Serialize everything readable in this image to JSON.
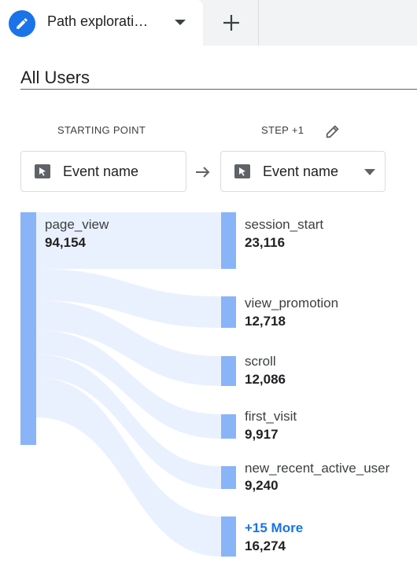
{
  "tabs": {
    "active_label": "Path explorati…",
    "active_icon": "pencil-icon",
    "dropdown_icon": "caret-down-icon",
    "add_icon": "plus-icon"
  },
  "segment": {
    "label": "All Users"
  },
  "columns": {
    "start_heading": "STARTING POINT",
    "step_heading": "STEP +1",
    "step_edit_icon": "pencil-icon",
    "start_dimension": "Event name",
    "step_dimension": "Event name",
    "dimension_icon": "cursor-box-icon",
    "arrow_icon": "arrow-right-icon"
  },
  "start_node": {
    "name": "page_view",
    "value": "94,154"
  },
  "step_nodes": [
    {
      "name": "session_start",
      "value": "23,116"
    },
    {
      "name": "view_promotion",
      "value": "12,718"
    },
    {
      "name": "scroll",
      "value": "12,086"
    },
    {
      "name": "first_visit",
      "value": "9,917"
    },
    {
      "name": "new_recent_active_user",
      "value": "9,240"
    },
    {
      "name": "+15 More",
      "value": "16,274"
    }
  ],
  "colors": {
    "accent": "#1a73e8",
    "bar": "#8ab4f8",
    "flow": "#e8f0fe"
  }
}
